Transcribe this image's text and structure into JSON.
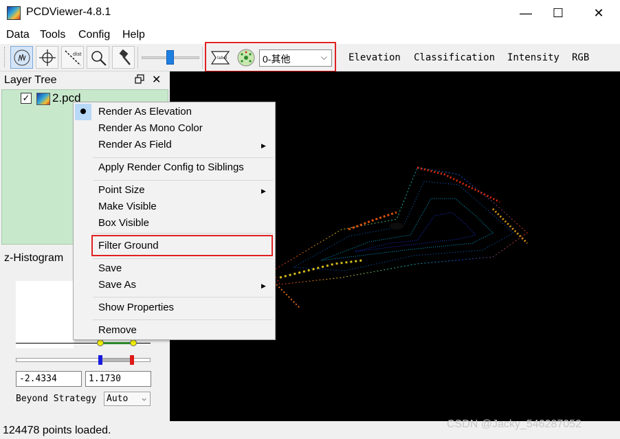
{
  "window": {
    "title": "PCDViewer-4.8.1",
    "minimize": "—",
    "maximize": "☐",
    "close": "✕"
  },
  "menu": [
    "Data",
    "Tools",
    "Config",
    "Help"
  ],
  "toolbar": {
    "tools": [
      "select-tool",
      "crosshair-tool",
      "distance-tool",
      "zoom-tool",
      "pick-tool"
    ],
    "dist_label": "dist",
    "label_icon_text": "label",
    "classification_select": "0-其他",
    "render_modes": [
      "Elevation",
      "Classification",
      "Intensity",
      "RGB"
    ]
  },
  "layer_tree": {
    "title": "Layer Tree",
    "checkbox": "✓",
    "layer_name": "2.pcd"
  },
  "histogram": {
    "title": "z-Histogram",
    "min_value": "-2.4334",
    "max_value": "1.1730",
    "beyond_label": "Beyond Strategy",
    "beyond_value": "Auto"
  },
  "context_menu": {
    "items": [
      {
        "label": "Render As Elevation",
        "checked": true
      },
      {
        "label": "Render As Mono Color"
      },
      {
        "label": "Render As Field",
        "submenu": true
      },
      {
        "label": "Apply Render Config to Siblings"
      },
      {
        "label": "Point Size",
        "submenu": true
      },
      {
        "label": "Make Visible"
      },
      {
        "label": "Box Visible"
      },
      {
        "label": "Filter Ground",
        "highlighted": true
      },
      {
        "label": "Save"
      },
      {
        "label": "Save As",
        "submenu": true
      },
      {
        "label": "Show Properties"
      },
      {
        "label": "Remove"
      }
    ]
  },
  "status": {
    "text": "124478 points loaded.",
    "watermark": "CSDN @Jacky_546287052"
  },
  "colors": {
    "highlight_red": "#e02020",
    "layer_tree_bg": "#c8e8cc",
    "viewer_bg": "#000000"
  }
}
